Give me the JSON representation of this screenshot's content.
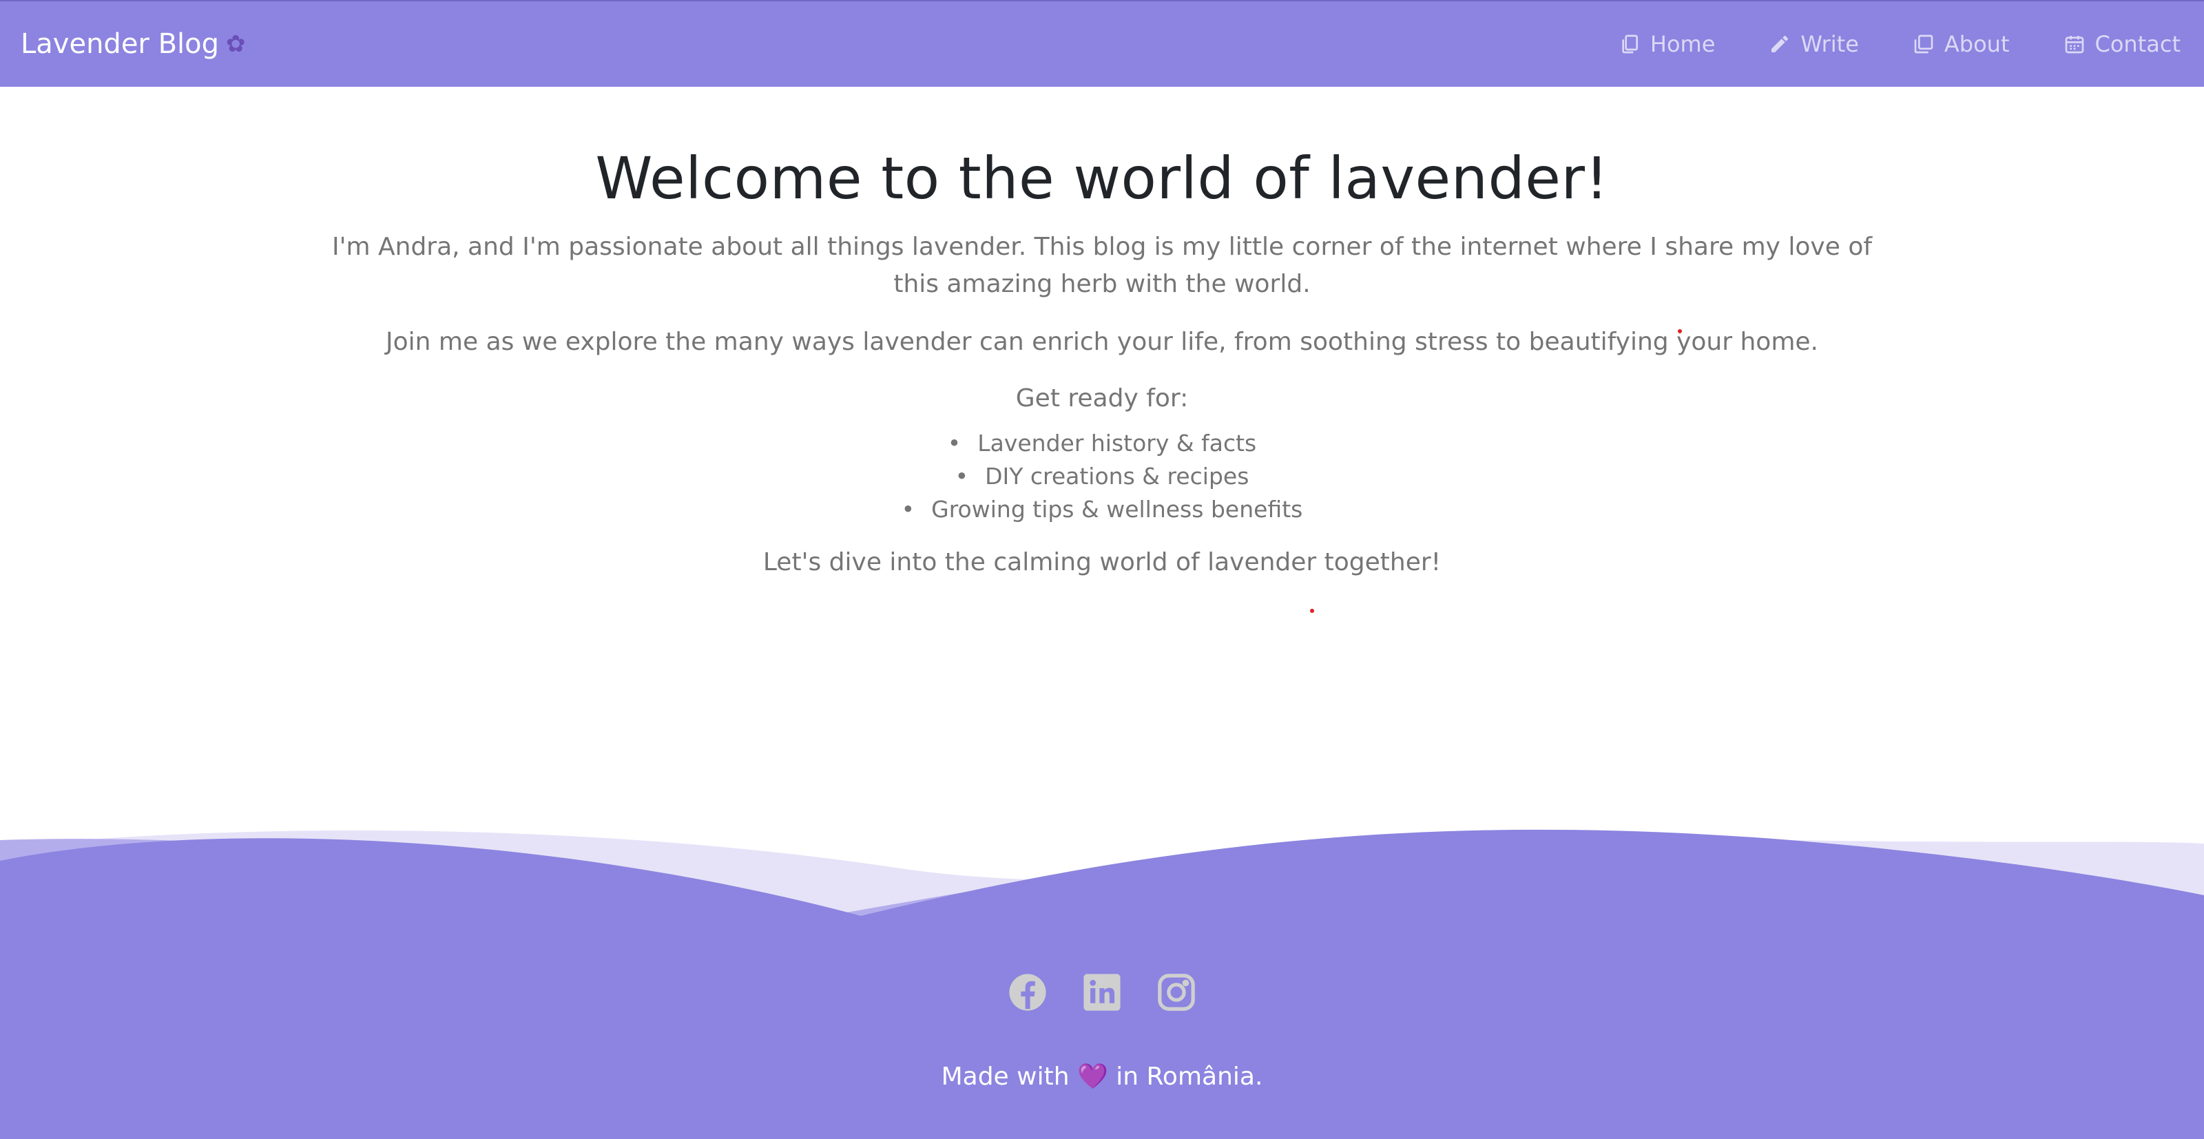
{
  "navbar": {
    "brand": "Lavender Blog",
    "brand_icon": "lavender-flower-icon",
    "items": [
      {
        "label": "Home",
        "icon": "copy-icon"
      },
      {
        "label": "Write",
        "icon": "pencil-icon"
      },
      {
        "label": "About",
        "icon": "stack-icon"
      },
      {
        "label": "Contact",
        "icon": "calendar-icon"
      }
    ]
  },
  "main": {
    "title": "Welcome to the world of lavender!",
    "intro": "I'm Andra, and I'm passionate about all things lavender. This blog is my little corner of the internet where I share my love of this amazing herb with the world.",
    "intro2": "Join me as we explore the many ways lavender can enrich your life, from soothing stress to beautifying your home.",
    "ready": "Get ready for:",
    "bullets": [
      "Lavender history & facts",
      "DIY creations & recipes",
      "Growing tips & wellness benefits"
    ],
    "outro": "Let's dive into the calming world of lavender together!"
  },
  "footer": {
    "social": [
      "facebook-icon",
      "linkedin-icon",
      "instagram-icon"
    ],
    "credit_before": "Made with",
    "credit_heart": "💜",
    "credit_after": "in România."
  },
  "colors": {
    "accent": "#8c84e0",
    "nav_text": "#dcd8f6",
    "title": "#212529",
    "body_text": "#757575",
    "social_icon": "#cfcfcf"
  }
}
